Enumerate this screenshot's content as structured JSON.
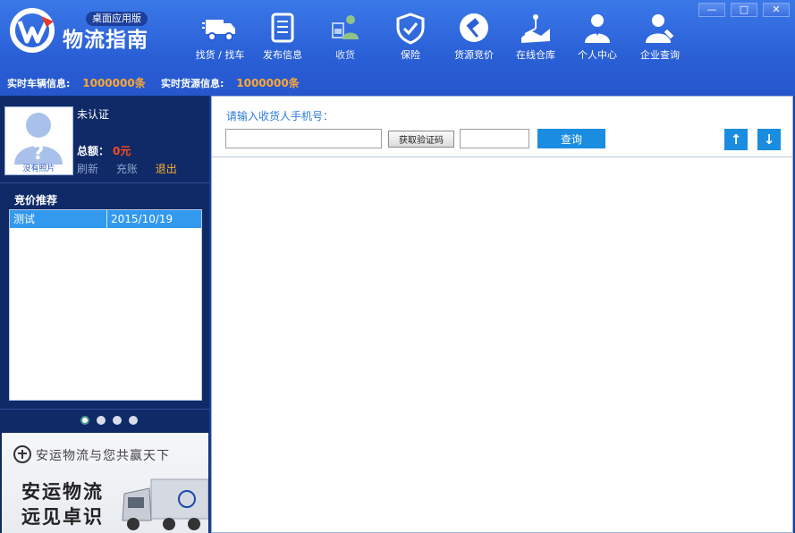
{
  "header": {
    "app_name": "物流指南",
    "edition": "桌面应用版",
    "nav": [
      {
        "label": "找货 / 找车",
        "icon": "truck-icon"
      },
      {
        "label": "发布信息",
        "icon": "document-icon"
      },
      {
        "label": "收货",
        "icon": "receive-goods-icon"
      },
      {
        "label": "保险",
        "icon": "shield-check-icon"
      },
      {
        "label": "货源竞价",
        "icon": "auction-hammer-icon"
      },
      {
        "label": "在线仓库",
        "icon": "warehouse-map-icon"
      },
      {
        "label": "个人中心",
        "icon": "user-icon"
      },
      {
        "label": "企业查询",
        "icon": "enterprise-user-icon"
      }
    ],
    "stats": {
      "vehicle_label": "实时车辆信息:",
      "vehicle_value": "1000000条",
      "goods_label": "实时货源信息:",
      "goods_value": "1000000条"
    },
    "window": {
      "minimize": "—",
      "maximize": "□",
      "close": "✕"
    }
  },
  "profile": {
    "avatar_caption": "没有照片",
    "auth_status": "未认证",
    "balance_label": "总额：",
    "balance_value": "0元",
    "refresh": "刷新",
    "recharge": "充账",
    "logout": "退出"
  },
  "bidding": {
    "title": "竞价推荐",
    "rows": [
      {
        "name": "测试",
        "date": "2015/10/19"
      }
    ]
  },
  "carousel": {
    "count": 4,
    "active": 0
  },
  "banner": {
    "slogan": "安运物流与您共赢天下",
    "title_line1": "安运物流",
    "title_line2": "远见卓识"
  },
  "main": {
    "prompt": "请输入收货人手机号：",
    "phone_value": "",
    "get_code": "获取验证码",
    "code_value": "",
    "query": "查询",
    "up": "↑",
    "down": "↓"
  },
  "colors": {
    "header": "#2a5fd6",
    "sidebar": "#0f2a67",
    "accent": "#1b8de0",
    "stat": "#ffa733",
    "money": "#ff4a1f"
  }
}
